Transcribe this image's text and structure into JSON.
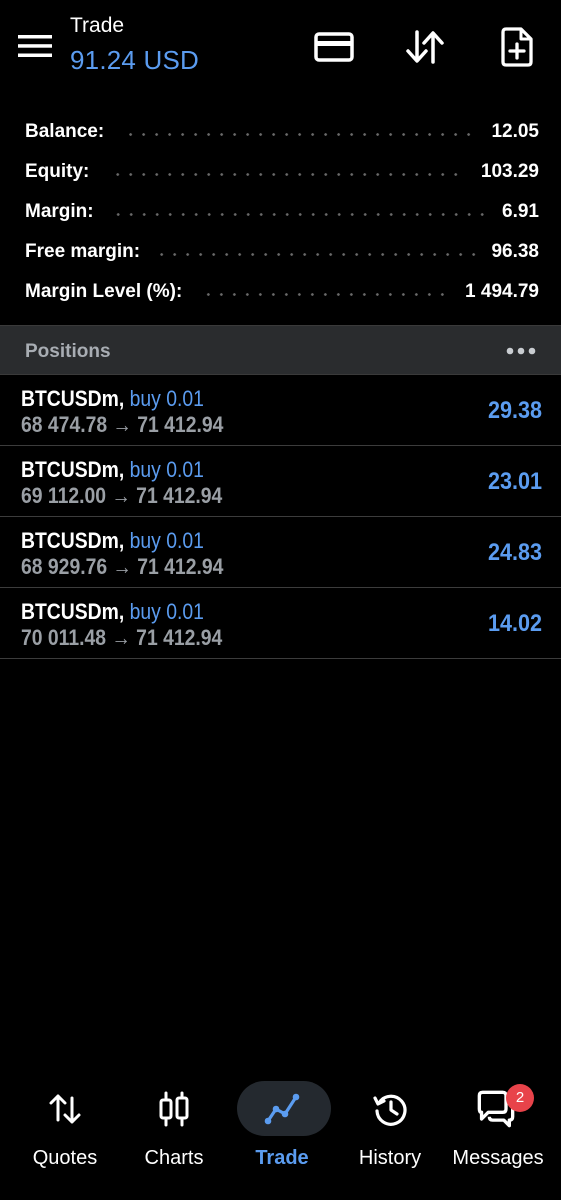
{
  "header": {
    "title": "Trade",
    "balance_display": "91.24 USD",
    "icons": [
      "menu-icon",
      "credit-card-icon",
      "sort-arrows-icon",
      "new-document-icon"
    ]
  },
  "summary": [
    {
      "label": "Balance:",
      "value": "12.05"
    },
    {
      "label": "Equity:",
      "value": "103.29"
    },
    {
      "label": "Margin:",
      "value": "6.91"
    },
    {
      "label": "Free margin:",
      "value": "96.38"
    },
    {
      "label": "Margin Level (%):",
      "value": "1 494.79"
    }
  ],
  "positions": {
    "title": "Positions",
    "rows": [
      {
        "symbol": "BTCUSDm,",
        "direction": "buy 0.01",
        "prices": "68 474.78 → 71 412.94",
        "profit": "29.38"
      },
      {
        "symbol": "BTCUSDm,",
        "direction": "buy 0.01",
        "prices": "69 112.00 → 71 412.94",
        "profit": "23.01"
      },
      {
        "symbol": "BTCUSDm,",
        "direction": "buy 0.01",
        "prices": "68 929.76 → 71 412.94",
        "profit": "24.83"
      },
      {
        "symbol": "BTCUSDm,",
        "direction": "buy 0.01",
        "prices": "70 011.48 → 71 412.94",
        "profit": "14.02"
      }
    ]
  },
  "nav": [
    {
      "label": "Quotes",
      "icon": "quotes-arrows-icon"
    },
    {
      "label": "Charts",
      "icon": "candlestick-icon"
    },
    {
      "label": "Trade",
      "icon": "trade-line-icon",
      "active": true
    },
    {
      "label": "History",
      "icon": "history-clock-icon"
    },
    {
      "label": "Messages",
      "icon": "messages-icon",
      "badge": "2"
    }
  ],
  "colors": {
    "accent": "#5b9cf0",
    "badge": "#e8434a",
    "background": "#000000"
  }
}
